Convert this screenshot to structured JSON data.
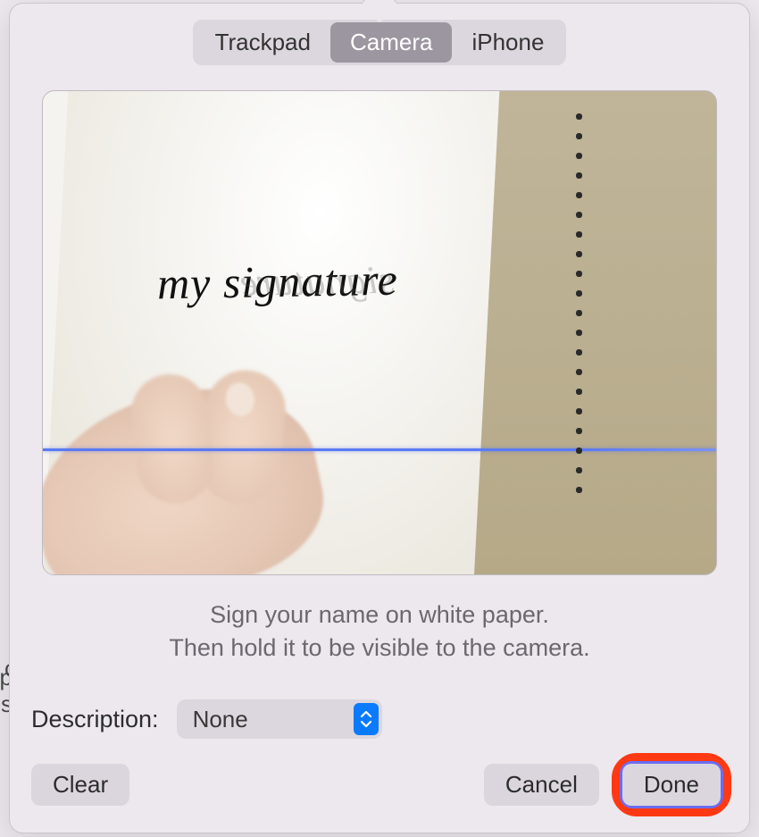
{
  "tabs": {
    "trackpad": "Trackpad",
    "camera": "Camera",
    "iphone": "iPhone",
    "active": "camera"
  },
  "preview": {
    "signature_text": "my signature",
    "ghost_text": "signature"
  },
  "instructions": {
    "line1": "Sign your name on white paper.",
    "line2": "Then hold it to be visible to the camera."
  },
  "description": {
    "label": "Description:",
    "selected": "None"
  },
  "buttons": {
    "clear": "Clear",
    "cancel": "Cancel",
    "done": "Done"
  },
  "edge": {
    "c": "c",
    "p": "p",
    "s": "s"
  }
}
